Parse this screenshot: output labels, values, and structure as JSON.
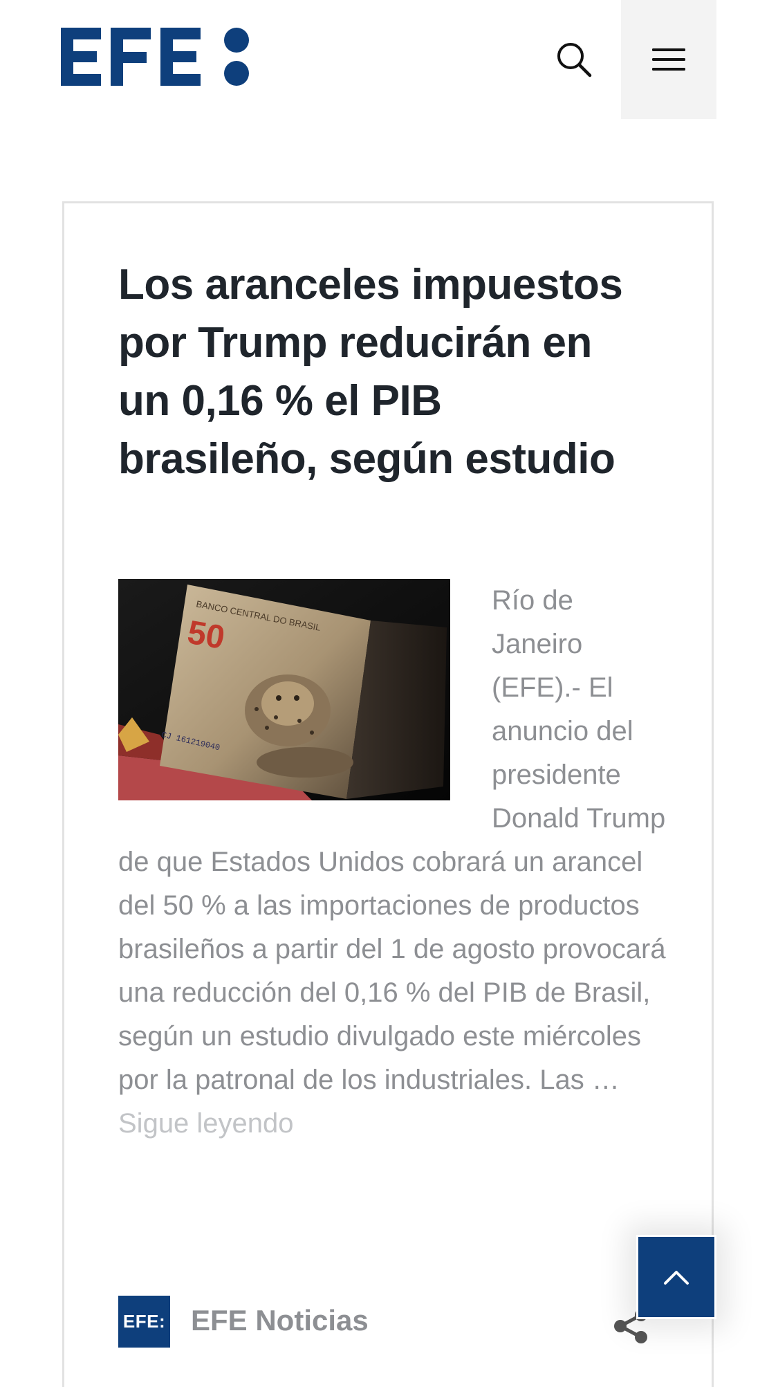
{
  "header": {
    "logo_text": "EFE:",
    "search_icon": "search-icon",
    "menu_icon": "hamburger-menu-icon",
    "menu_bg_color": "#f3f3f3"
  },
  "article": {
    "headline": "Los aranceles impuestos por Trump reducirán en un 0,16 % el PIB brasileño, según estudio",
    "image_subject": "Billete de 50 reales del Banco Central do Brasil",
    "excerpt": "Río de Janeiro (EFE).- El anuncio del presidente Donald Trump de que Estados Unidos cobrará un arancel del 50 % a las importaciones de productos brasileños a partir del 1 de agosto provocará una reducción del 0,16 % del PIB de Brasil, según un estudio divulgado este miércoles por la patronal de los industriales. Las …",
    "read_more_label": "Sigue leyendo"
  },
  "author": {
    "logo_text": "EFE:",
    "name": "EFE Noticias",
    "share_icon": "share-icon"
  },
  "back_to_top": {
    "icon": "chevron-up-icon"
  },
  "colors": {
    "brand": "#0e3f7c",
    "headline": "#1f252c",
    "body_text": "#8d8f93",
    "read_more": "#c2c4c7",
    "card_border": "#e2e2e2"
  }
}
